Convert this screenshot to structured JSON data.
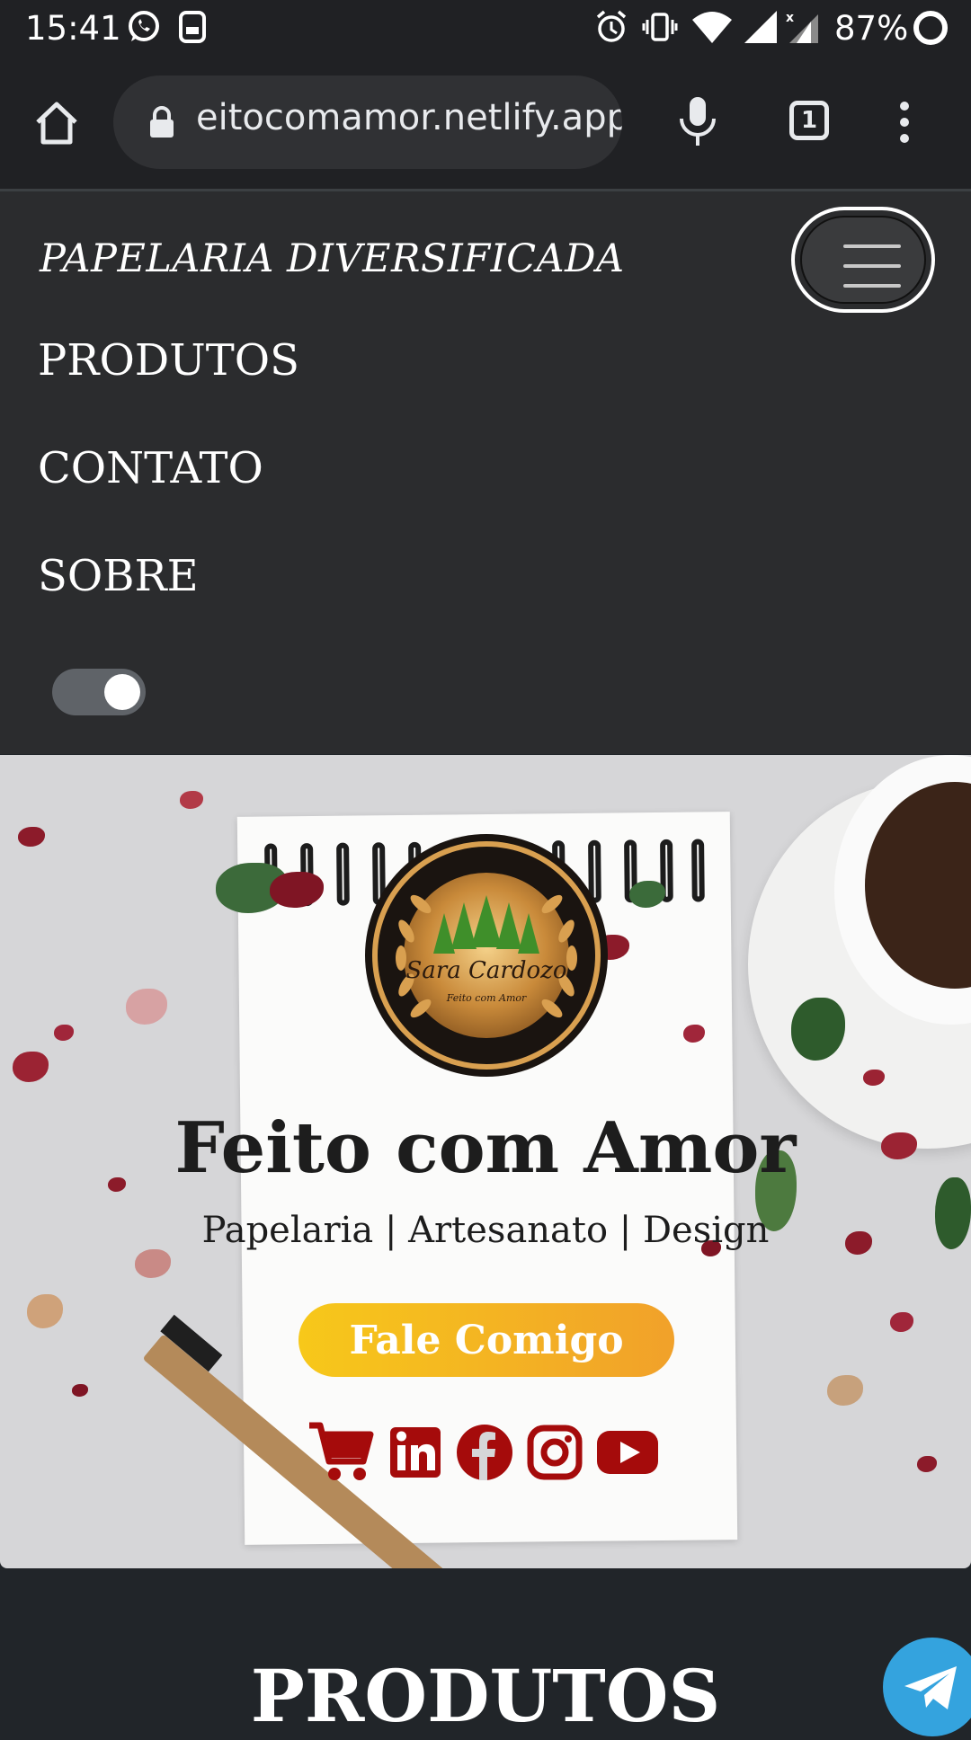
{
  "status_bar": {
    "time": "15:41",
    "battery": "87%",
    "icons": [
      "whatsapp-icon",
      "sim-icon",
      "alarm-icon",
      "vibrate-icon",
      "wifi-icon",
      "signal-icon",
      "signal-x-icon",
      "battery-ring-icon"
    ]
  },
  "browser": {
    "url": "eitocomamor.netlify.app",
    "tab_count": "1"
  },
  "nav": {
    "brand": "PAPELARIA DIVERSIFICADA",
    "links": [
      "PRODUTOS",
      "CONTATO",
      "SOBRE"
    ],
    "dark_mode_on": true
  },
  "hero": {
    "logo_text": "Sara Cardozo",
    "logo_subtext": "Feito com Amor",
    "title": "Feito com Amor",
    "subtitle": "Papelaria | Artesanato | Design",
    "cta_label": "Fale Comigo",
    "social_icons": [
      "cart-icon",
      "linkedin-icon",
      "facebook-icon",
      "instagram-icon",
      "youtube-icon"
    ],
    "accent_color": "#a50b0b"
  },
  "section": {
    "title": "PRODUTOS"
  }
}
